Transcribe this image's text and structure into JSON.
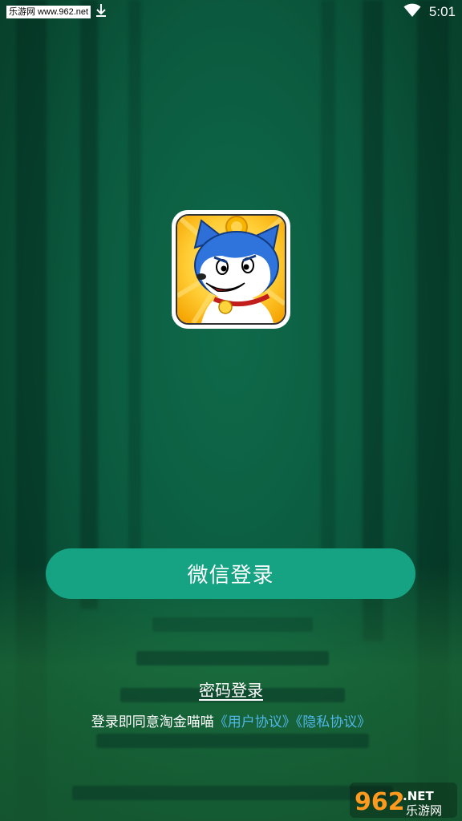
{
  "status_bar": {
    "watermark": "乐游网 www.962.net",
    "time": "5:01",
    "download_icon": "download-icon",
    "wifi_icon": "wifi-icon"
  },
  "app": {
    "icon": "cartoon-cat-app-icon"
  },
  "login": {
    "wechat_label": "微信登录",
    "password_label": "密码登录"
  },
  "agreement": {
    "prefix": "登录即同意淘金喵喵",
    "user_agreement": "《用户协议》",
    "privacy_agreement": "《隐私协议》"
  },
  "watermark_logo": {
    "number": "962",
    "suffix": ".NET",
    "site": "乐游网"
  },
  "colors": {
    "background": "#0b5a3f",
    "primary_button": "#15a383",
    "link": "#4fb6e8",
    "text": "#ffffff"
  }
}
